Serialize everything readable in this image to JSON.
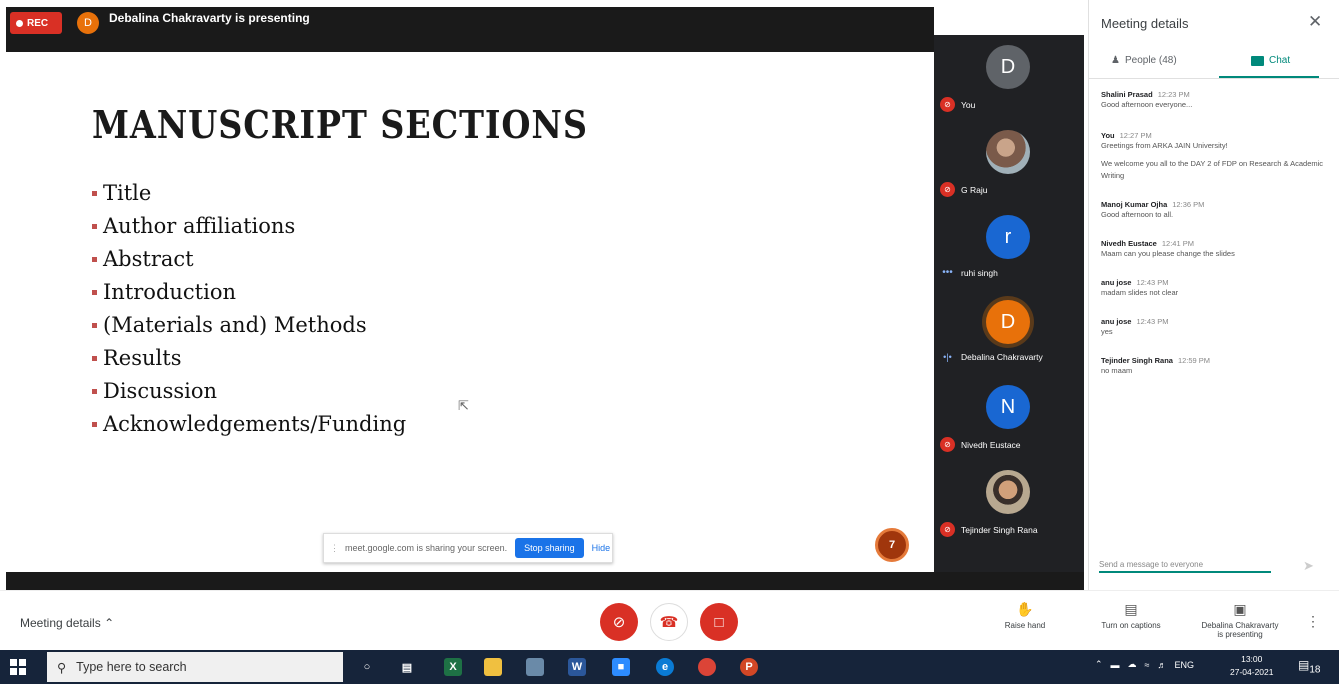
{
  "topbar": {
    "rec_label": "REC",
    "presenter_initial": "D",
    "presenting_text": "Debalina Chakravarty is presenting"
  },
  "slide": {
    "title": "MANUSCRIPT SECTIONS",
    "bullets": [
      "Title",
      "Author affiliations",
      "Abstract",
      "Introduction",
      "(Materials and) Methods",
      "Results",
      "Discussion",
      "Acknowledgements/Funding"
    ],
    "page_number": "7"
  },
  "share_banner": {
    "text": "meet.google.com is sharing your screen.",
    "stop_label": "Stop sharing",
    "hide_label": "Hide"
  },
  "participants": [
    {
      "initial": "D",
      "name": "You",
      "color": "#5f6368",
      "status": "muted"
    },
    {
      "initial": "",
      "name": "G Raju",
      "color": "",
      "status": "muted"
    },
    {
      "initial": "r",
      "name": "ruhi singh",
      "color": "#1967d2",
      "status": "dots"
    },
    {
      "initial": "D",
      "name": "Debalina Chakravarty",
      "color": "#e8710a",
      "status": "speaking"
    },
    {
      "initial": "N",
      "name": "Nivedh Eustace",
      "color": "#1967d2",
      "status": "muted"
    },
    {
      "initial": "",
      "name": "Tejinder Singh Rana",
      "color": "",
      "status": "muted"
    }
  ],
  "side_panel": {
    "title": "Meeting details",
    "people_tab": "People (48)",
    "chat_tab": "Chat",
    "messages": [
      {
        "sender": "Shalini Prasad",
        "time": "12:23 PM",
        "text": "Good afternoon everyone...",
        "text2": ""
      },
      {
        "sender": "You",
        "time": "12:27 PM",
        "text": "Greetings from ARKA JAIN University!",
        "text2": "We welcome you all to the DAY 2 of FDP on Research & Academic Writing"
      },
      {
        "sender": "Manoj Kumar Ojha",
        "time": "12:36 PM",
        "text": "Good afternoon to all.",
        "text2": ""
      },
      {
        "sender": "Nivedh Eustace",
        "time": "12:41 PM",
        "text": "Maam can you please change the slides",
        "text2": ""
      },
      {
        "sender": "anu jose",
        "time": "12:43 PM",
        "text": "madam slides not clear",
        "text2": ""
      },
      {
        "sender": "anu jose",
        "time": "12:43 PM",
        "text": "yes",
        "text2": ""
      },
      {
        "sender": "Tejinder Singh Rana",
        "time": "12:59 PM",
        "text": "no maam",
        "text2": ""
      }
    ],
    "input_placeholder": "Send a message to everyone"
  },
  "controls": {
    "meeting_details": "Meeting details",
    "raise_hand": "Raise hand",
    "captions": "Turn on captions",
    "presenting_line1": "Debalina Chakravarty",
    "presenting_line2": "is presenting"
  },
  "taskbar": {
    "search_placeholder": "Type here to search",
    "lang": "ENG",
    "time": "13:00",
    "date": "27-04-2021",
    "notifications": "18"
  }
}
